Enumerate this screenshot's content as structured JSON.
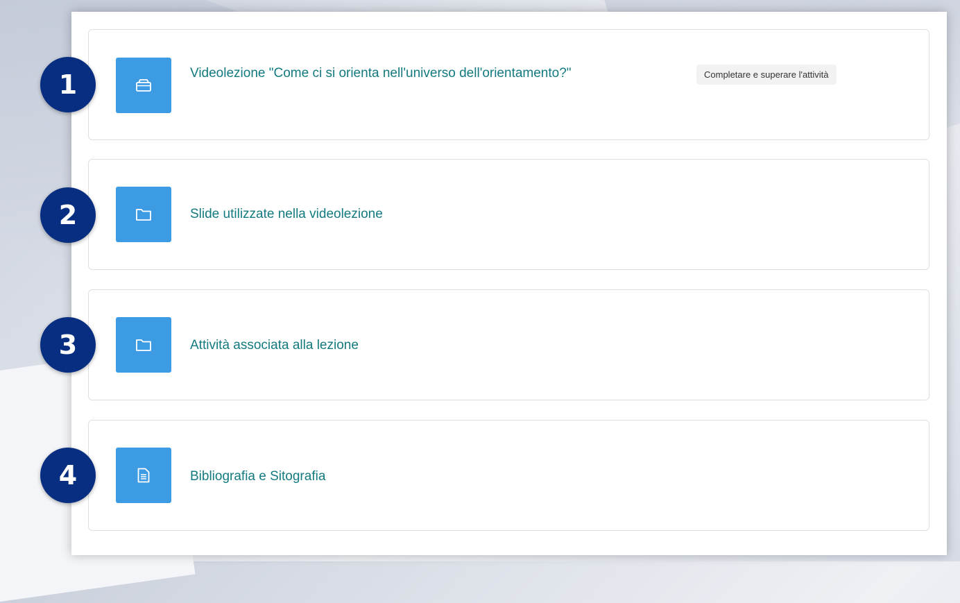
{
  "markers": [
    "1",
    "2",
    "3",
    "4"
  ],
  "activities": [
    {
      "icon": "box-icon",
      "title": "Videolezione \"Come ci si orienta nell'universo dell'orientamento?\"",
      "completion": "Completare e superare l'attività"
    },
    {
      "icon": "folder-icon",
      "title": "Slide utilizzate nella videolezione"
    },
    {
      "icon": "folder-icon",
      "title": "Attività associata alla lezione"
    },
    {
      "icon": "document-icon",
      "title": "Bibliografia e Sitografia"
    }
  ],
  "colors": {
    "icon_bg": "#3c9be2",
    "title_link": "#137a7f",
    "marker_bg": "#072e80"
  }
}
